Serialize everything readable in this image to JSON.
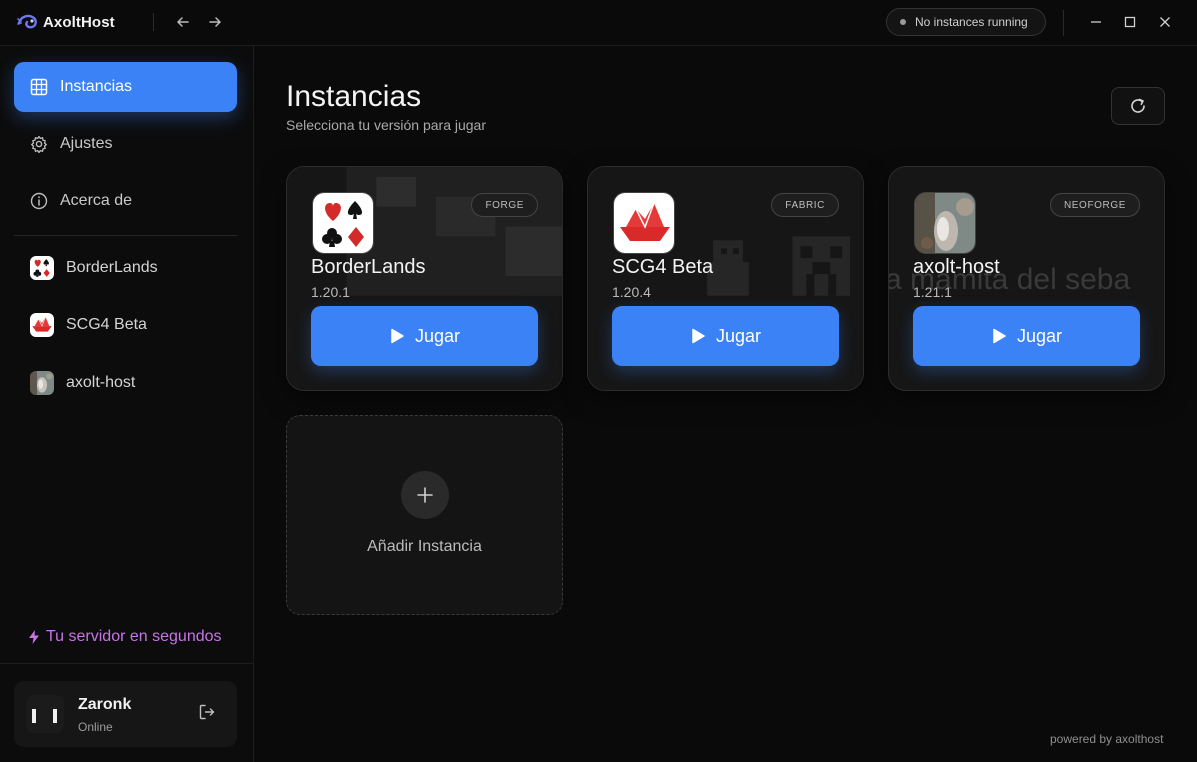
{
  "app": {
    "name": "AxoltHost"
  },
  "titlebar": {
    "status_text": "No instances running"
  },
  "sidebar": {
    "nav": [
      {
        "label": "Instancias",
        "icon": "grid-icon",
        "active": true
      },
      {
        "label": "Ajustes",
        "icon": "gear-icon",
        "active": false
      },
      {
        "label": "Acerca de",
        "icon": "info-icon",
        "active": false
      }
    ],
    "instances": [
      {
        "label": "BorderLands"
      },
      {
        "label": "SCG4 Beta"
      },
      {
        "label": "axolt-host"
      }
    ],
    "promo": "Tu servidor en segundos",
    "user": {
      "name": "Zaronk",
      "status": "Online"
    }
  },
  "main": {
    "title": "Instancias",
    "subtitle": "Selecciona tu versión para jugar",
    "cards": [
      {
        "name": "BorderLands",
        "version": "1.20.1",
        "loader": "FORGE",
        "play_label": "Jugar"
      },
      {
        "name": "SCG4 Beta",
        "version": "1.20.4",
        "loader": "FABRIC",
        "play_label": "Jugar"
      },
      {
        "name": "axolt-host",
        "version": "1.21.1",
        "loader": "NEOFORGE",
        "play_label": "Jugar",
        "bg_text": "a mamita del seba"
      }
    ],
    "add_label": "Añadir Instancia"
  },
  "footer": {
    "powered": "powered by axolthost"
  },
  "colors": {
    "accent": "#3b82f6",
    "promo": "#c774e8",
    "background": "#0a0a0a"
  }
}
